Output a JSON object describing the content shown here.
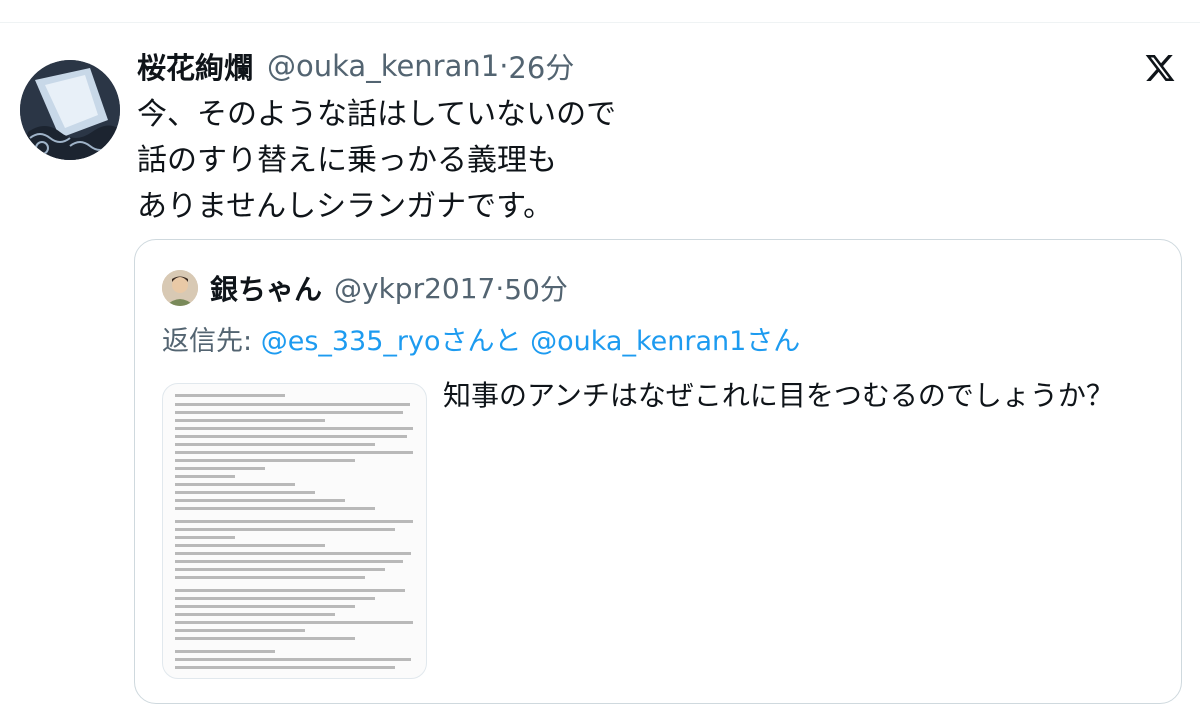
{
  "tweet": {
    "author_name": "桜花絢爛",
    "handle": "@ouka_kenran1",
    "separator": "·",
    "time": "26分",
    "lines": [
      "今、そのような話はしていないので",
      "話のすり替えに乗っかる義理も",
      "ありませんしシランガナです。"
    ],
    "avatar_icon": "fan-wave-illustration-icon",
    "platform_icon": "x-logo-icon"
  },
  "quoted_tweet": {
    "author_name": "銀ちゃん",
    "handle": "@ykpr2017",
    "separator": "·",
    "time": "50分",
    "reply_label": "返信先:",
    "reply_mention_1": "@es_335_ryo",
    "reply_joiner": "さんと",
    "reply_mention_2": "@ouka_kenran1",
    "reply_suffix": "さん",
    "text": "知事のアンチはなぜこれに目をつむるのでしょうか？",
    "media": "document-screenshot-image"
  },
  "colors": {
    "text_primary": "#0f1419",
    "text_secondary": "#536471",
    "link": "#1d9bf0",
    "border": "#cfd9de"
  }
}
